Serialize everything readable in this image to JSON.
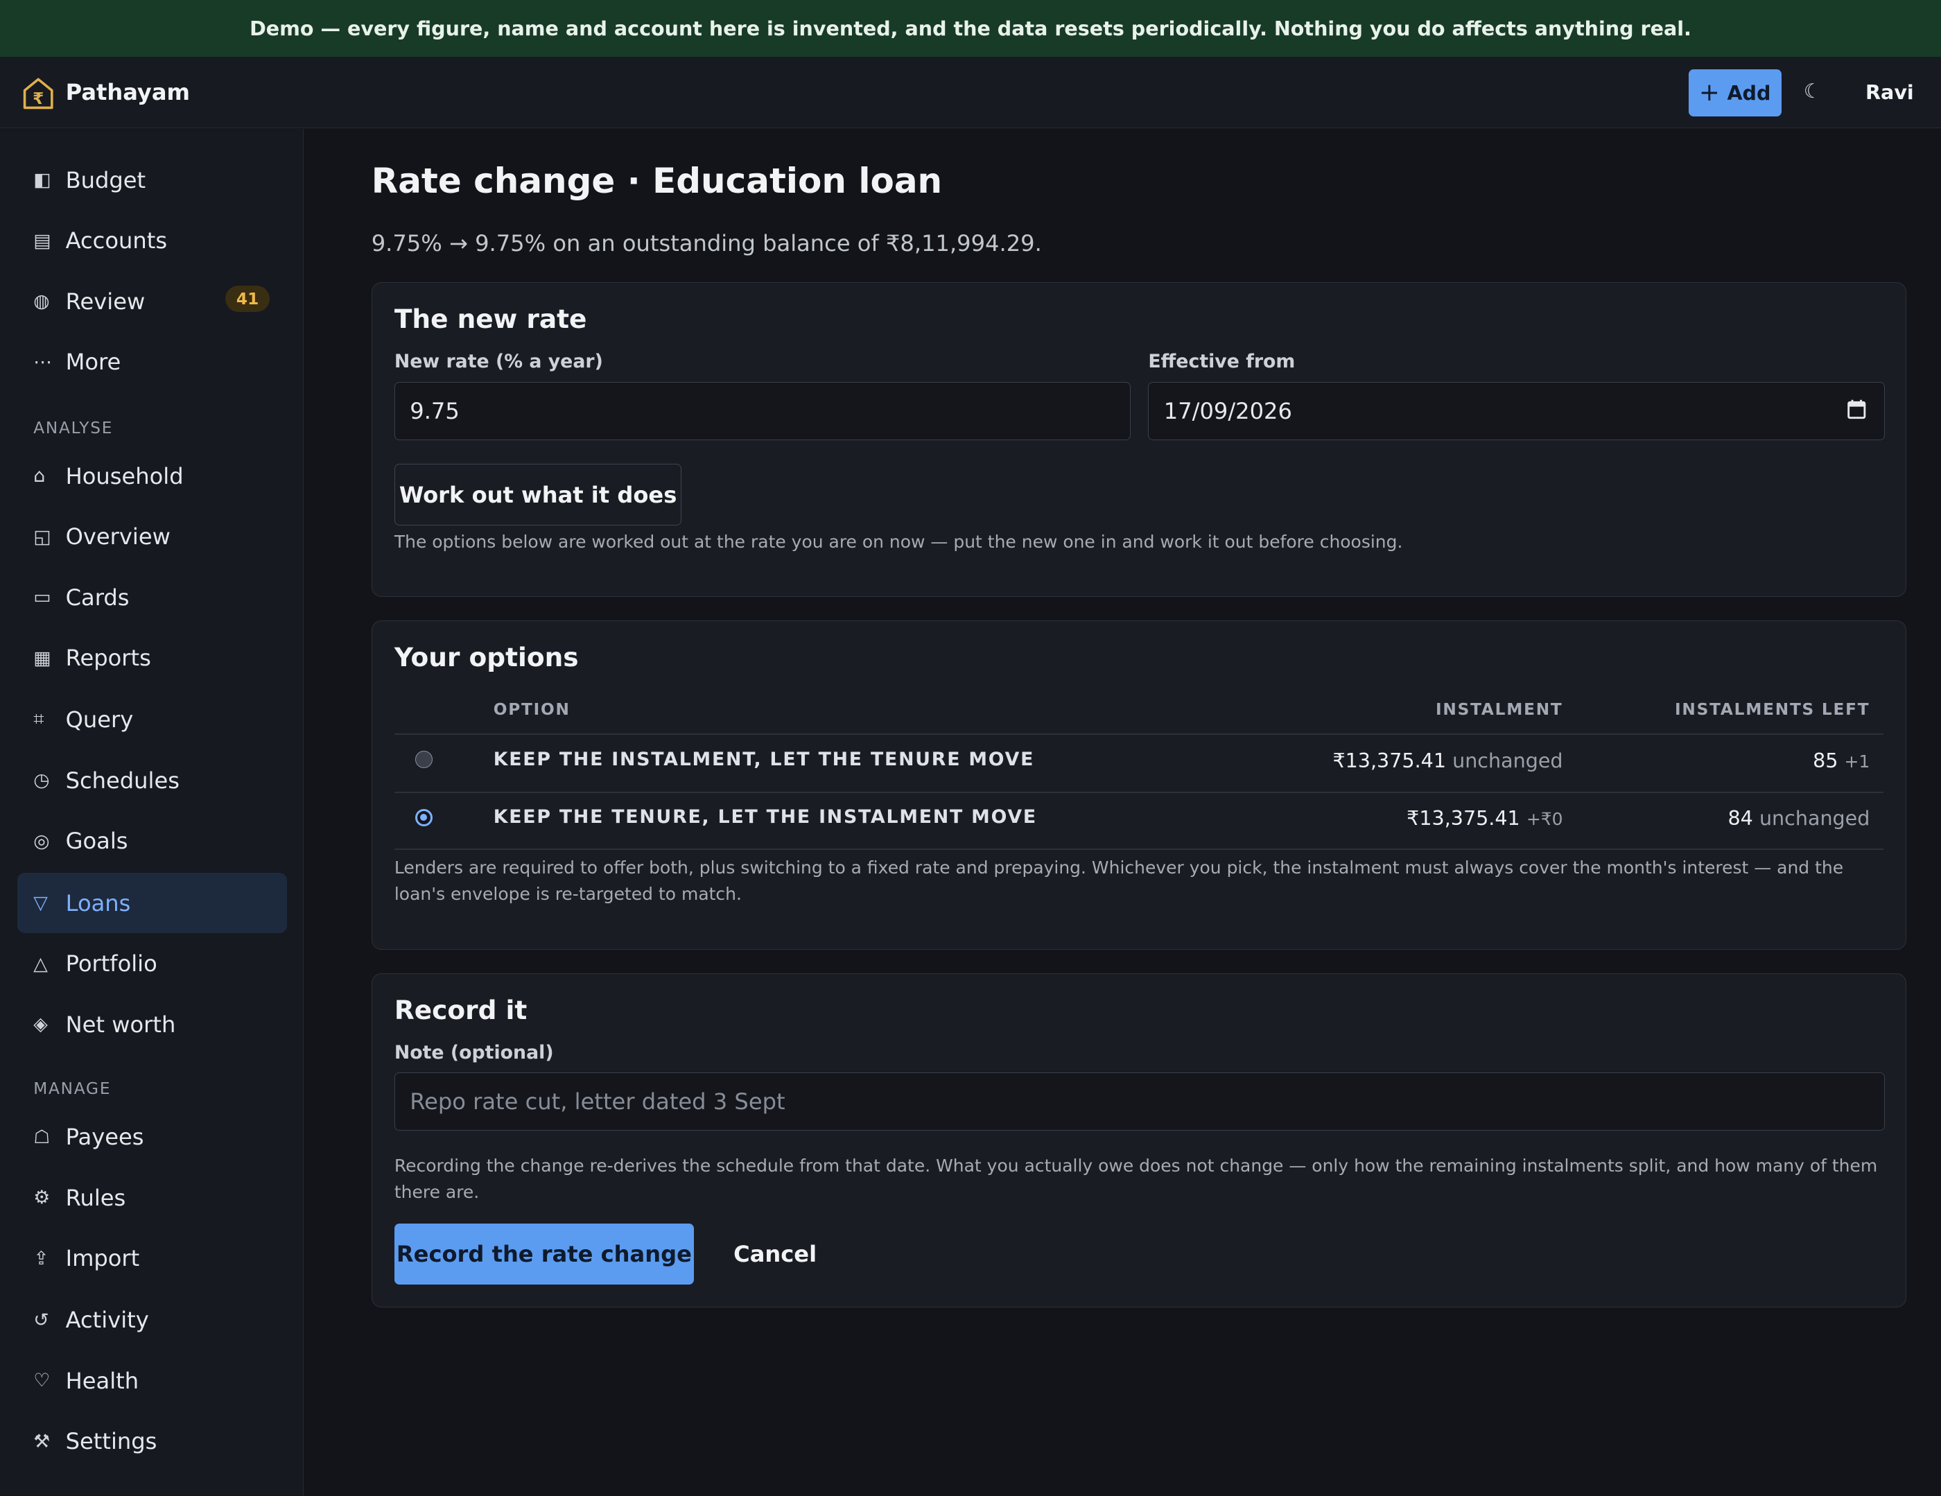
{
  "banner": {
    "text": "Demo — every figure, name and account here is invented, and the data resets periodically. Nothing you do affects anything real."
  },
  "header": {
    "brand": "Pathayam",
    "logo_icon": "house-rupee-icon",
    "add_label": "Add",
    "add_icon": "+",
    "theme_icon": "☾",
    "user": "Ravi"
  },
  "sidebar": {
    "items": [
      {
        "label": "Budget",
        "icon": "◧"
      },
      {
        "label": "Accounts",
        "icon": "▤"
      },
      {
        "label": "Review",
        "icon": "◍",
        "badge": "41"
      },
      {
        "label": "More",
        "icon": "⋯"
      }
    ],
    "analyse_label": "ANALYSE",
    "analyse": [
      {
        "label": "Household",
        "icon": "⌂"
      },
      {
        "label": "Overview",
        "icon": "◱"
      },
      {
        "label": "Cards",
        "icon": "▭"
      },
      {
        "label": "Reports",
        "icon": "▦"
      },
      {
        "label": "Query",
        "icon": "⌗"
      },
      {
        "label": "Schedules",
        "icon": "◷"
      },
      {
        "label": "Goals",
        "icon": "◎"
      },
      {
        "label": "Loans",
        "icon": "▽",
        "active": true
      },
      {
        "label": "Portfolio",
        "icon": "△"
      },
      {
        "label": "Net worth",
        "icon": "◈"
      }
    ],
    "manage_label": "MANAGE",
    "manage": [
      {
        "label": "Payees",
        "icon": "☖"
      },
      {
        "label": "Rules",
        "icon": "⚙"
      },
      {
        "label": "Import",
        "icon": "⇪"
      },
      {
        "label": "Activity",
        "icon": "↺"
      },
      {
        "label": "Health",
        "icon": "♡"
      },
      {
        "label": "Settings",
        "icon": "⚒"
      }
    ]
  },
  "page": {
    "title": "Rate change · Education loan",
    "subtitle": "9.75% → 9.75% on an outstanding balance of ₹8,11,994.29."
  },
  "new_rate": {
    "title": "The new rate",
    "rate_label": "New rate (% a year)",
    "rate_value": "9.75",
    "effective_label": "Effective from",
    "effective_value": "17/09/2026",
    "work_out_label": "Work out what it does",
    "hint": "The options below are worked out at the rate you are on now — put the new one in and work it out before choosing."
  },
  "options": {
    "title": "Your options",
    "col_option": "OPTION",
    "col_instalment": "INSTALMENT",
    "col_left": "INSTALMENTS LEFT",
    "rows": [
      {
        "label": "KEEP THE INSTALMENT, LET THE TENURE MOVE",
        "instalment": "₹13,375.41",
        "instalment_note": "unchanged",
        "left": "85",
        "left_note": "+1",
        "selected": false
      },
      {
        "label": "KEEP THE TENURE, LET THE INSTALMENT MOVE",
        "instalment": "₹13,375.41",
        "instalment_note": "+₹0",
        "left": "84",
        "left_note": "unchanged",
        "selected": true
      }
    ],
    "hint": "Lenders are required to offer both, plus switching to a fixed rate and prepaying. Whichever you pick, the instalment must always cover the month's interest — and the loan's envelope is re-targeted to match."
  },
  "record": {
    "title": "Record it",
    "note_label": "Note (optional)",
    "note_placeholder": "Repo rate cut, letter dated 3 Sept",
    "hint": "Recording the change re-derives the schedule from that date. What you actually owe does not change — only how the remaining instalments split, and how many of them there are.",
    "submit_label": "Record the rate change",
    "cancel_label": "Cancel"
  }
}
